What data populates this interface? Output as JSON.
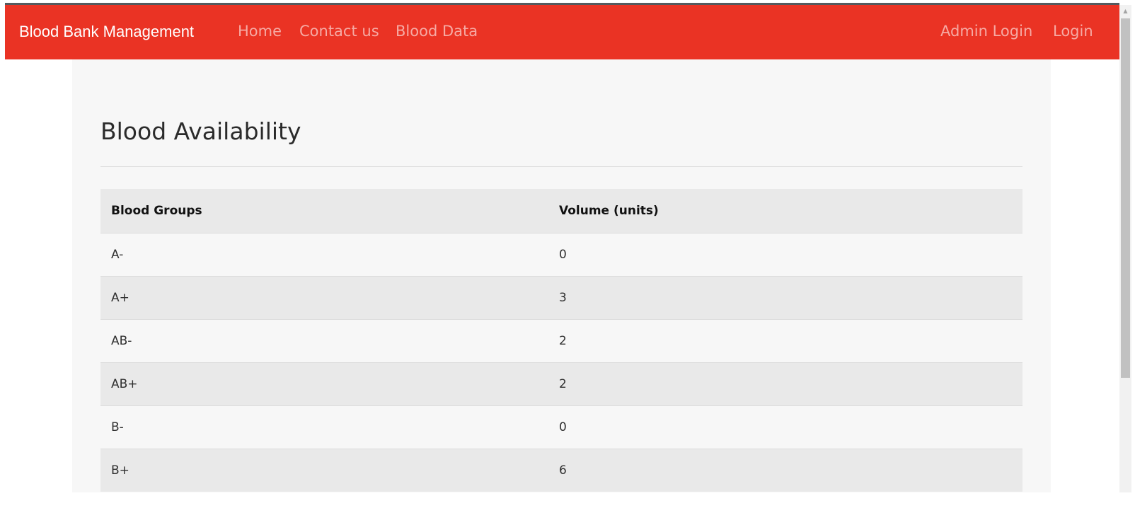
{
  "navbar": {
    "brand": "Blood Bank Management",
    "links": [
      "Home",
      "Contact us",
      "Blood Data"
    ],
    "right_links": [
      "Admin Login",
      "Login"
    ],
    "bg_color": "#ea3324"
  },
  "main": {
    "title": "Blood Availability",
    "table": {
      "headers": [
        "Blood Groups",
        "Volume (units)"
      ],
      "rows": [
        [
          "A-",
          "0"
        ],
        [
          "A+",
          "3"
        ],
        [
          "AB-",
          "2"
        ],
        [
          "AB+",
          "2"
        ],
        [
          "B-",
          "0"
        ],
        [
          "B+",
          "6"
        ]
      ]
    }
  }
}
